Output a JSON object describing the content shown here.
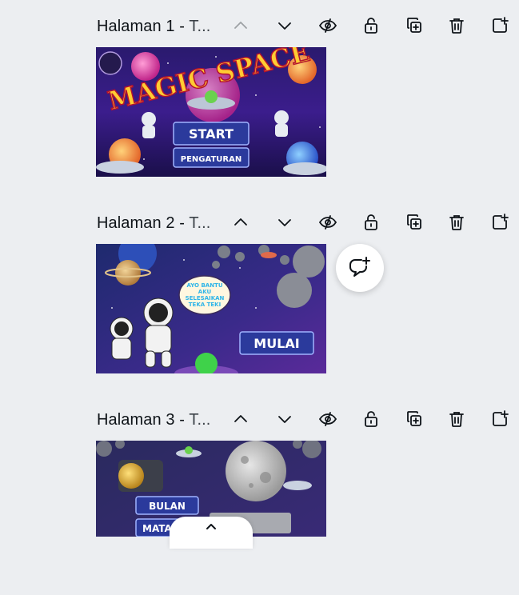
{
  "pages": [
    {
      "title": "Halaman 1 - ",
      "subtitle": "T...",
      "thumbnail": {
        "headline": "MAGIC SPACE",
        "buttons": [
          "START",
          "PENGATURAN"
        ]
      }
    },
    {
      "title": "Halaman 2 - ",
      "subtitle": "T...",
      "thumbnail": {
        "speech_bubble": [
          "AYO BANTU",
          "AKU",
          "SELESAIKAN",
          "TEKA TEKI"
        ],
        "buttons": [
          "MULAI"
        ]
      }
    },
    {
      "title": "Halaman 3 - ",
      "subtitle": "T...",
      "thumbnail": {
        "buttons": [
          "BULAN",
          "MATAH"
        ]
      }
    }
  ],
  "toolbar_icons": [
    "chevron-up-icon",
    "chevron-down-icon",
    "hide-icon",
    "unlock-icon",
    "duplicate-icon",
    "trash-icon",
    "add-page-icon"
  ],
  "colors": {
    "background": "#eceef1",
    "icon": "#0e1318",
    "button_blue": "#2b3a9c"
  }
}
